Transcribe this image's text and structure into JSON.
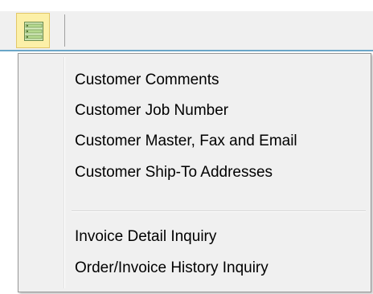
{
  "toolbar": {
    "menu_button_icon": "list-menu-icon",
    "colors": {
      "button_bg": "#fcf0a8",
      "accent_line": "#6aa6c8"
    }
  },
  "dropdown": {
    "group1": [
      {
        "label": "Customer Comments"
      },
      {
        "label": "Customer Job Number"
      },
      {
        "label": "Customer Master, Fax and Email"
      },
      {
        "label": "Customer Ship-To Addresses"
      }
    ],
    "group2": [
      {
        "label": "Invoice Detail Inquiry"
      },
      {
        "label": "Order/Invoice History Inquiry"
      }
    ]
  }
}
